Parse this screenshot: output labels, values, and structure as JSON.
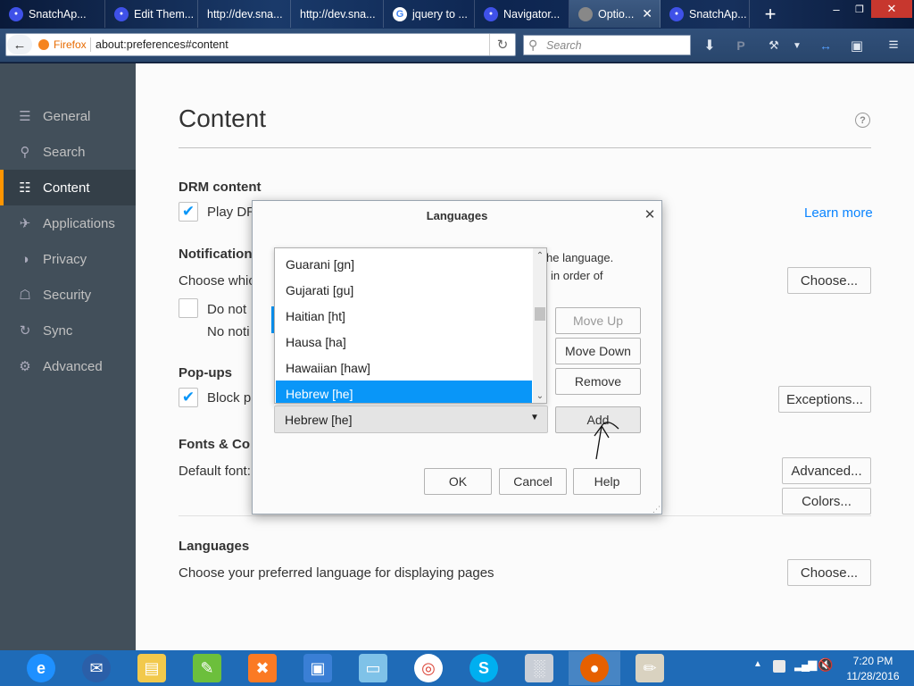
{
  "tabs": [
    {
      "label": "SnatchAp...",
      "icon": "tab-favicon-icon",
      "active": false
    },
    {
      "label": "Edit Them...",
      "icon": "tab-favicon-icon",
      "active": false
    },
    {
      "label": "http://dev.sna...",
      "icon": "",
      "active": false
    },
    {
      "label": "http://dev.sna...",
      "icon": "",
      "active": false
    },
    {
      "label": "jquery to ...",
      "icon": "google-icon",
      "active": false
    },
    {
      "label": "Navigator...",
      "icon": "tab-favicon-icon",
      "active": false
    },
    {
      "label": "Optio...",
      "icon": "options-gear-icon",
      "active": true
    },
    {
      "label": "SnatchAp...",
      "icon": "tab-favicon-icon",
      "active": false
    }
  ],
  "newtab_label": "+",
  "urlbar": {
    "brand": "Firefox",
    "url": "about:preferences#content"
  },
  "searchbar": {
    "placeholder": "Search"
  },
  "sidebar": {
    "items": [
      {
        "label": "General",
        "icon": "general-icon"
      },
      {
        "label": "Search",
        "icon": "search-icon"
      },
      {
        "label": "Content",
        "icon": "content-icon",
        "selected": true
      },
      {
        "label": "Applications",
        "icon": "applications-icon"
      },
      {
        "label": "Privacy",
        "icon": "privacy-icon"
      },
      {
        "label": "Security",
        "icon": "security-icon"
      },
      {
        "label": "Sync",
        "icon": "sync-icon"
      },
      {
        "label": "Advanced",
        "icon": "advanced-icon"
      }
    ]
  },
  "content": {
    "title": "Content",
    "drm": {
      "heading": "DRM content",
      "checkbox_label": "Play DR",
      "link": "Learn more"
    },
    "notifications": {
      "heading": "Notification",
      "desc": "Choose whic",
      "choose_button": "Choose...",
      "checkbox_label": "Do not",
      "sub": "No noti"
    },
    "popups": {
      "heading": "Pop-ups",
      "checkbox_label": "Block p",
      "exceptions_button": "Exceptions..."
    },
    "fonts": {
      "heading": "Fonts & Co",
      "default_font": "Default font:",
      "advanced_button": "Advanced...",
      "colors_button": "Colors..."
    },
    "languages": {
      "heading": "Languages",
      "desc": "Choose your preferred language for displaying pages",
      "choose_button": "Choose..."
    }
  },
  "dialog": {
    "title": "Languages",
    "desc_line1": "he language.",
    "desc_line2": "in order of",
    "options": [
      "Guarani  [gn]",
      "Gujarati  [gu]",
      "Haitian  [ht]",
      "Hausa  [ha]",
      "Hawaiian  [haw]",
      "Hebrew  [he]"
    ],
    "selected_option": "Hebrew  [he]",
    "select_value": "Hebrew  [he]",
    "buttons": {
      "move_up": "Move Up",
      "move_down": "Move Down",
      "remove": "Remove",
      "add": "Add",
      "ok": "OK",
      "cancel": "Cancel",
      "help": "Help"
    }
  },
  "taskbar": {
    "apps": [
      "internet-explorer",
      "thunderbird",
      "file-explorer",
      "notepad-plus",
      "xampp",
      "virtualbox",
      "sticky-notes",
      "chrome",
      "skype",
      "system-monitor",
      "firefox",
      "paint"
    ],
    "active_app": "firefox",
    "time": "7:20 PM",
    "date": "11/28/2016"
  }
}
